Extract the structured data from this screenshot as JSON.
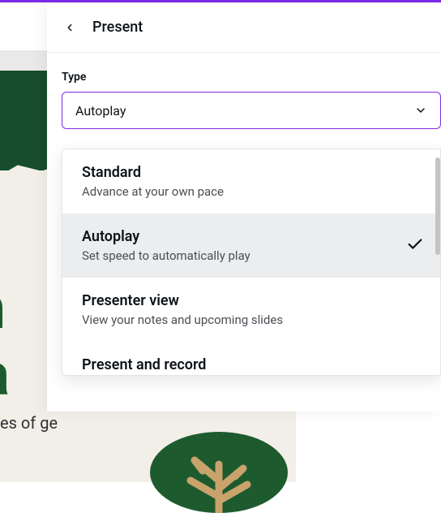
{
  "panel": {
    "title": "Present",
    "type_label": "Type",
    "selected_value": "Autoplay"
  },
  "options": [
    {
      "title": "Standard",
      "desc": "Advance at your own pace",
      "selected": false
    },
    {
      "title": "Autoplay",
      "desc": "Set speed to automatically play",
      "selected": true
    },
    {
      "title": "Presenter view",
      "desc": "View your notes and upcoming slides",
      "selected": false
    },
    {
      "title": "Present and record",
      "desc": "",
      "selected": false
    }
  ],
  "slide": {
    "heading_line1": "din",
    "heading_line2": "gra",
    "subline": "es of ge"
  }
}
